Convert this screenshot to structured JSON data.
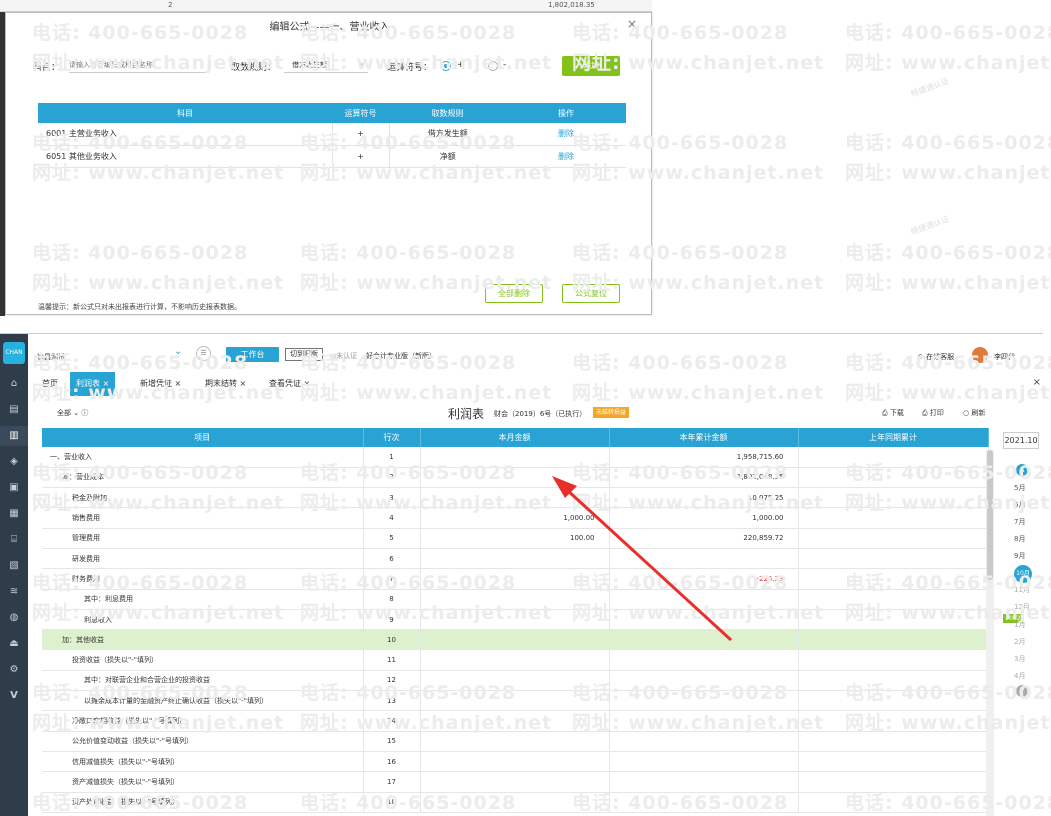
{
  "background": {
    "row_index": "2",
    "row_value": "1,802,018.35"
  },
  "dialog": {
    "title": "编辑公式——一、营业收入",
    "close": "×",
    "subject_label": "科目：",
    "subject_placeholder": "请输入科目编码或科目名称",
    "rule_label": "取数规则：",
    "rule_value": "借方发生额",
    "operator_label": "运算符号：",
    "plus": "+",
    "minus": "-",
    "add_button": "添加",
    "table": {
      "headers": [
        "科目",
        "运算符号",
        "取数规则",
        "操作"
      ],
      "rows": [
        {
          "subject": "6001 主营业务收入",
          "op": "+",
          "rule": "借方发生额",
          "action": "删除"
        },
        {
          "subject": "6051 其他业务收入",
          "op": "+",
          "rule": "净额",
          "action": "删除"
        }
      ]
    },
    "tip": "温馨提示：新公式只对未出报表进行计算，不影响历史报表数据。",
    "delete_all": "全部删除",
    "reset_formula": "公式复位"
  },
  "watermark": {
    "phone": "电话: 400-665-0028",
    "site": "网址: www.chanjet.net",
    "stamp": "畅捷通认证"
  },
  "sidebar": {
    "logo": "CHAN",
    "icons": [
      "home-icon",
      "voucher-icon",
      "report-icon",
      "cash-icon",
      "invoice-icon",
      "ledger-icon",
      "asset-icon",
      "inventory-icon",
      "payroll-icon",
      "tax-icon",
      "archive-icon",
      "settings-icon",
      "v-icon"
    ]
  },
  "topbar": {
    "company": "徐昌测试",
    "workbench": "工作台",
    "switch_old": "切到旧版",
    "verified": "◎未认证",
    "product": "好会计专业版（新版）",
    "support": "在线客服",
    "user": "李四代"
  },
  "tabs": [
    {
      "label": "首页",
      "active": false
    },
    {
      "label": "利润表 ×",
      "active": true
    },
    {
      "label": "新增凭证 ×",
      "active": false
    },
    {
      "label": "期末结转 ×",
      "active": false
    },
    {
      "label": "查看凭证 ×",
      "active": false
    }
  ],
  "tabs_close": "×",
  "toolbar": {
    "filter": "全部",
    "title": "利润表",
    "subtitle": "财会（2019）6号（已执行）",
    "badge": "未结转损益",
    "download": "下载",
    "print": "打印",
    "refresh": "刷新"
  },
  "report": {
    "headers": [
      "项目",
      "行次",
      "本月金额",
      "本年累计金额",
      "上年同期累计"
    ],
    "rows": [
      {
        "item": "一、营业收入",
        "line": "1",
        "month": "",
        "year": "1,958,715.60",
        "prev": "",
        "indent": 0
      },
      {
        "item": "减：营业成本",
        "line": "2",
        "month": "",
        "year": "1,802,018.35",
        "prev": "",
        "indent": 1
      },
      {
        "item": "税金及附加",
        "line": "3",
        "month": "",
        "year": "10,075.25",
        "prev": "",
        "indent": 2
      },
      {
        "item": "销售费用",
        "line": "4",
        "month": "1,000.00",
        "year": "1,000.00",
        "prev": "",
        "indent": 2
      },
      {
        "item": "管理费用",
        "line": "5",
        "month": "100.00",
        "year": "220,859.72",
        "prev": "",
        "indent": 2
      },
      {
        "item": "研发费用",
        "line": "6",
        "month": "",
        "year": "",
        "prev": "",
        "indent": 2
      },
      {
        "item": "财务费用",
        "line": "7",
        "month": "",
        "year": "-226.23",
        "prev": "",
        "indent": 2
      },
      {
        "item": "其中：利息费用",
        "line": "8",
        "month": "",
        "year": "",
        "prev": "",
        "indent": 3
      },
      {
        "item": "利息收入",
        "line": "9",
        "month": "",
        "year": "",
        "prev": "",
        "indent": 3
      },
      {
        "item": "加：其他收益",
        "line": "10",
        "month": "",
        "year": "",
        "prev": "",
        "indent": 1
      },
      {
        "item": "投资收益（损失以\"-\"填列）",
        "line": "11",
        "month": "",
        "year": "",
        "prev": "",
        "indent": 2
      },
      {
        "item": "其中：对联营企业和合营企业的投资收益",
        "line": "12",
        "month": "",
        "year": "",
        "prev": "",
        "indent": 3
      },
      {
        "item": "以摊余成本计量的金融资产终止确认收益（损失以\"-\"填列）",
        "line": "13",
        "month": "",
        "year": "",
        "prev": "",
        "indent": 3
      },
      {
        "item": "净敞口套期收益（损失以\"-\"号填列）",
        "line": "14",
        "month": "",
        "year": "",
        "prev": "",
        "indent": 2
      },
      {
        "item": "公允价值变动收益（损失以\"-\"号填列）",
        "line": "15",
        "month": "",
        "year": "",
        "prev": "",
        "indent": 2
      },
      {
        "item": "信用减值损失（损失以\"-\"号填列）",
        "line": "16",
        "month": "",
        "year": "",
        "prev": "",
        "indent": 2
      },
      {
        "item": "资产减值损失（损失以\"-\"号填列）",
        "line": "17",
        "month": "",
        "year": "",
        "prev": "",
        "indent": 2
      },
      {
        "item": "资产处置收益（损失以\"-\"号填列）",
        "line": "18",
        "month": "",
        "year": "",
        "prev": "",
        "indent": 2
      }
    ]
  },
  "date_panel": {
    "value": "2021.10",
    "months_before": [
      "5月",
      "6月",
      "7月",
      "8月",
      "9月"
    ],
    "active": "10月",
    "months_after": [
      "11月",
      "12月"
    ],
    "year_tag": "2022",
    "months_next": [
      "1月",
      "2月",
      "3月",
      "4月"
    ]
  },
  "colors": {
    "accent": "#29a3d4",
    "green": "#83c21b",
    "highlight_row": "#def1cf",
    "negative": "#e0303a",
    "annotation_arrow": "#e8302a"
  }
}
